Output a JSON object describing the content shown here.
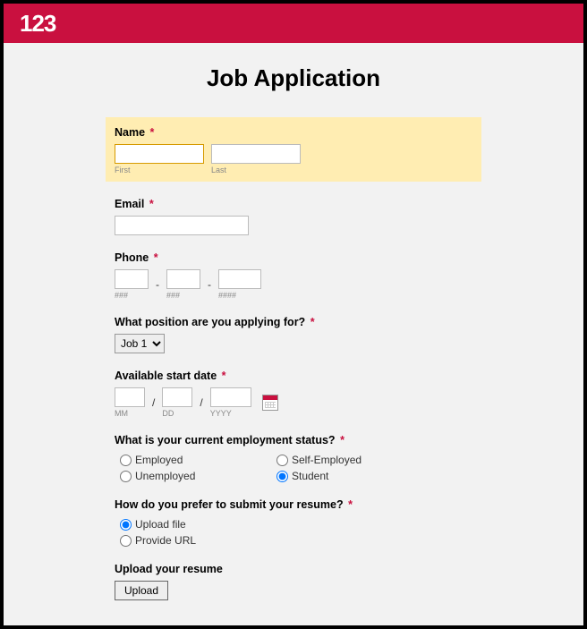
{
  "brand": {
    "logo_text": "123"
  },
  "title": "Job Application",
  "fields": {
    "name": {
      "label": "Name",
      "required_marker": "*",
      "first_sub": "First",
      "last_sub": "Last"
    },
    "email": {
      "label": "Email",
      "required_marker": "*"
    },
    "phone": {
      "label": "Phone",
      "required_marker": "*",
      "sub1": "###",
      "sub2": "###",
      "sub3": "####",
      "separator": "-"
    },
    "position": {
      "label": "What position are you applying for?",
      "required_marker": "*",
      "selected": "Job 1"
    },
    "start_date": {
      "label": "Available start date",
      "required_marker": "*",
      "sub1": "MM",
      "sub2": "DD",
      "sub3": "YYYY",
      "separator": "/"
    },
    "employment_status": {
      "label": "What is your current employment status?",
      "required_marker": "*",
      "options": {
        "o1": "Employed",
        "o2": "Self-Employed",
        "o3": "Unemployed",
        "o4": "Student"
      },
      "selected": "Student"
    },
    "resume_method": {
      "label": "How do you prefer to submit your resume?",
      "required_marker": "*",
      "options": {
        "o1": "Upload file",
        "o2": "Provide URL"
      },
      "selected": "Upload file"
    },
    "upload": {
      "label": "Upload your resume",
      "button": "Upload"
    }
  }
}
